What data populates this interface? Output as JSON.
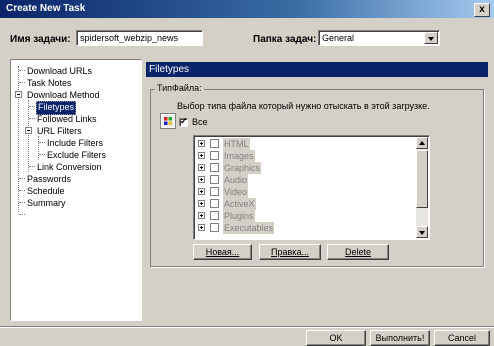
{
  "window": {
    "title": "Create New Task",
    "close_glyph": "x"
  },
  "task": {
    "name_label": "Имя задачи:",
    "name_value": "spidersoft_webzip_news",
    "folder_label": "Папка задач:",
    "folder_value": "General"
  },
  "tree": [
    {
      "label": "Download URLs"
    },
    {
      "label": "Task Notes"
    },
    {
      "label": "Download Method"
    },
    {
      "label": "Filetypes",
      "selected": true
    },
    {
      "label": "Followed Links"
    },
    {
      "label": "URL Filters"
    },
    {
      "label": "Include Filters"
    },
    {
      "label": "Exclude Filters"
    },
    {
      "label": "Link Conversion"
    },
    {
      "label": "Passwords"
    },
    {
      "label": "Schedule"
    },
    {
      "label": "Summary"
    }
  ],
  "panel": {
    "header": "Filetypes",
    "group_label": "ТипФайла:",
    "description": "Выбор типа файла который нужно отыскать в этой загрузке.",
    "all_label": "Все",
    "all_checked": true,
    "types": [
      "HTML",
      "Images",
      "Graphics",
      "Audio",
      "Video",
      "ActiveX",
      "Plugins",
      "Executables"
    ],
    "buttons": {
      "new": "Новая...",
      "edit": "Правка...",
      "delete": "Delete"
    }
  },
  "footer": {
    "ok": "OK",
    "run": "Выполнить!",
    "cancel": "Cancel"
  },
  "colors": {
    "selection": "#0a246a",
    "face": "#d4d0c8"
  }
}
